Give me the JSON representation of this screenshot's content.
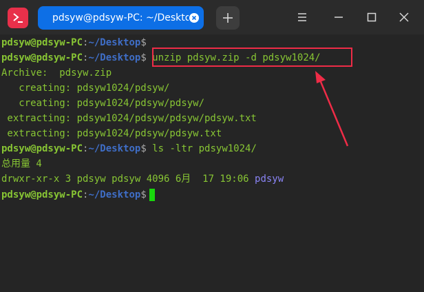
{
  "window": {
    "tab_title": "pdsyw@pdsyw-PC: ~/Desktop",
    "new_tab_icon": "plus-icon"
  },
  "prompt": {
    "user_host": "pdsyw@pdsyw-PC",
    "colon": ":",
    "path": "~/Desktop",
    "symbol": "$"
  },
  "terminal": {
    "cmd_unzip": " unzip pdsyw.zip -d pdsyw1024/",
    "out1": "Archive:  pdsyw.zip",
    "out2": "   creating: pdsyw1024/pdsyw/",
    "out3": "   creating: pdsyw1024/pdsyw/pdsyw/",
    "out4": " extracting: pdsyw1024/pdsyw/pdsyw/pdsyw.txt",
    "out5": " extracting: pdsyw1024/pdsyw/pdsyw.txt",
    "cmd_ls": " ls -ltr pdsyw1024/",
    "total": "总用量 4",
    "ls_perm": "drwxr-xr-x 3 pdsyw pdsyw 4096 6月  17 19:06 ",
    "ls_name": "pdsyw"
  },
  "colors": {
    "prompt_green": "#88c634",
    "path_blue": "#3f6ec7",
    "dir_purple": "#8a84f5",
    "annotation_red": "#ef2c47",
    "tab_blue": "#0d6fe6"
  }
}
